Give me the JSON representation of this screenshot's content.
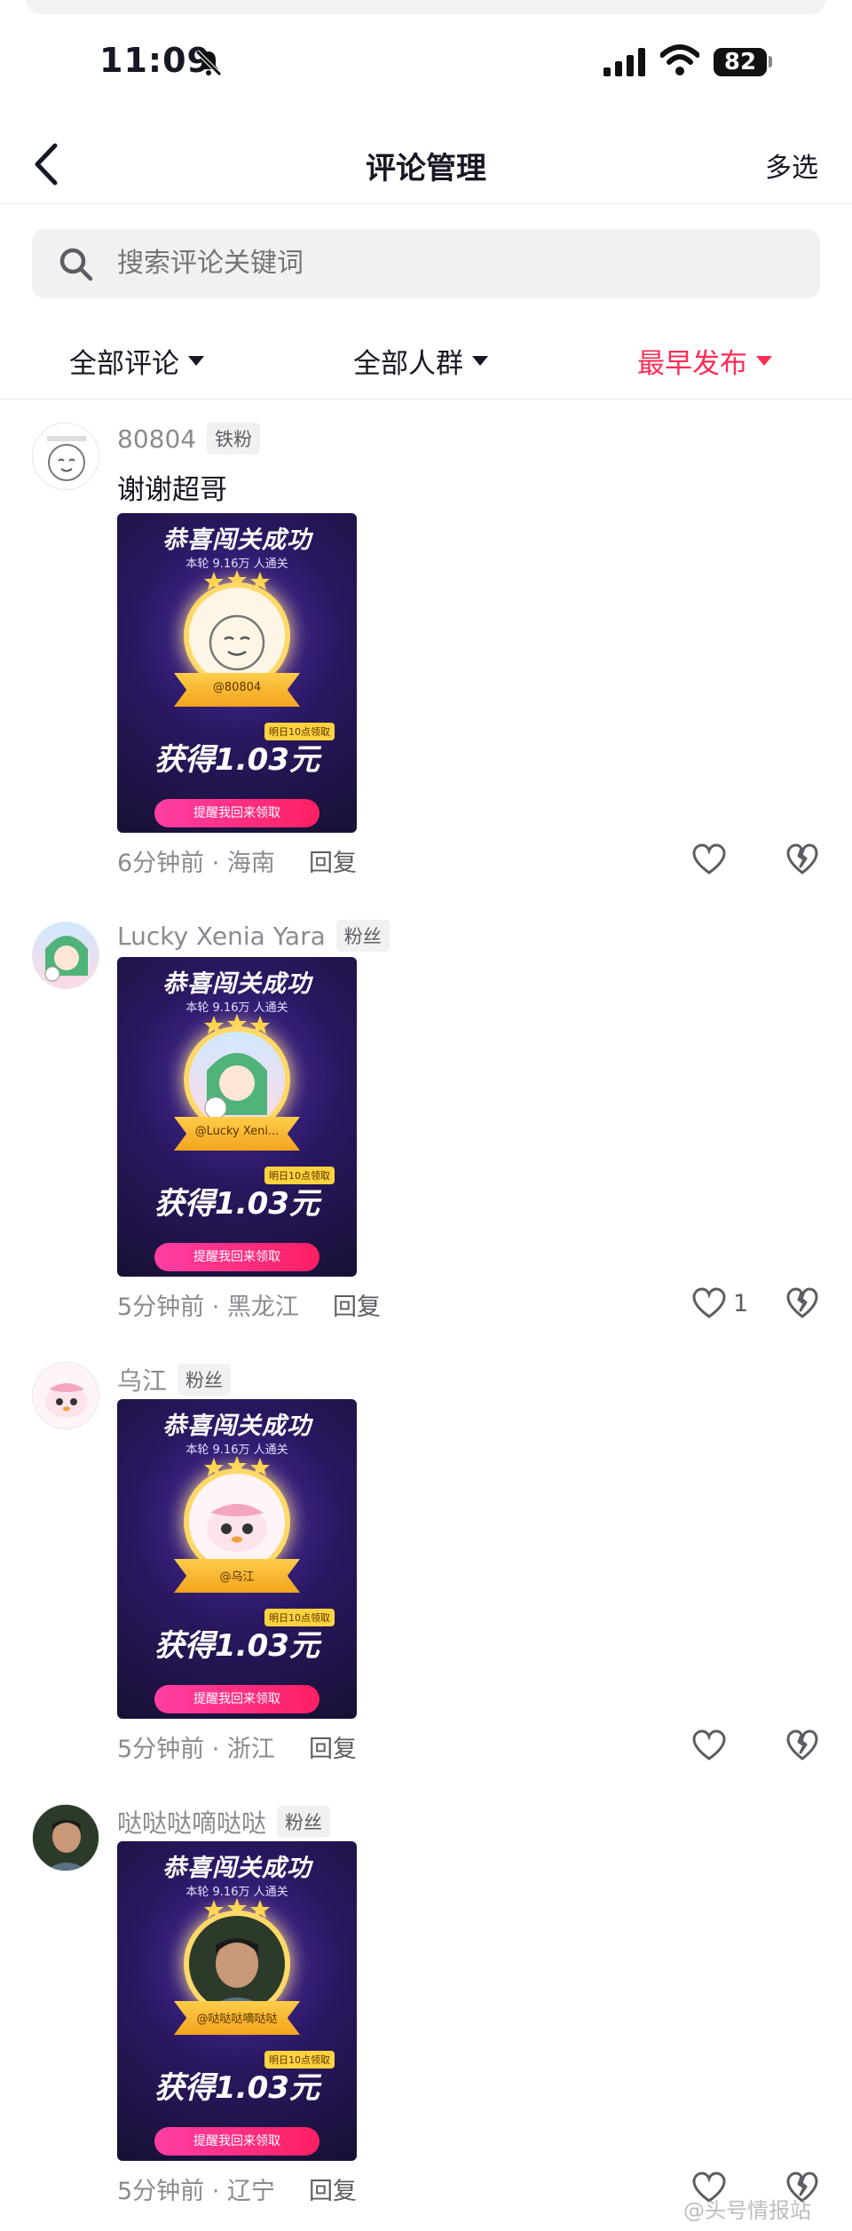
{
  "status_bar": {
    "time": "11:09",
    "battery": "82"
  },
  "nav": {
    "title": "评论管理",
    "multi_select": "多选"
  },
  "search": {
    "placeholder": "搜索评论关键词"
  },
  "filters": [
    {
      "label": "全部评论"
    },
    {
      "label": "全部人群"
    },
    {
      "label": "最早发布"
    }
  ],
  "colors": {
    "accent": "#fe2c55"
  },
  "cards": {
    "title": "恭喜闯关成功",
    "subtitle": "本轮 9.16万 人通关",
    "amount": "获得1.03元",
    "tag": "明日10点领取",
    "button": "提醒我回来领取"
  },
  "comments": [
    {
      "username": "80804",
      "badge": "铁粉",
      "text": "谢谢超哥",
      "card_name": "@80804",
      "meta": "6分钟前 · 海南",
      "reply": "回复",
      "likes": ""
    },
    {
      "username": "Lucky Xenia Yara",
      "badge": "粉丝",
      "text": "",
      "card_name": "@Lucky Xeni...",
      "meta": "5分钟前 · 黑龙江",
      "reply": "回复",
      "likes": "1"
    },
    {
      "username": "乌江",
      "badge": "粉丝",
      "text": "",
      "card_name": "@乌江",
      "meta": "5分钟前 · 浙江",
      "reply": "回复",
      "likes": ""
    },
    {
      "username": "哒哒哒嘀哒哒",
      "badge": "粉丝",
      "text": "",
      "card_name": "@哒哒哒嘀哒哒",
      "meta": "5分钟前 · 辽宁",
      "reply": "回复",
      "likes": ""
    }
  ],
  "watermark": "@头号情报站"
}
